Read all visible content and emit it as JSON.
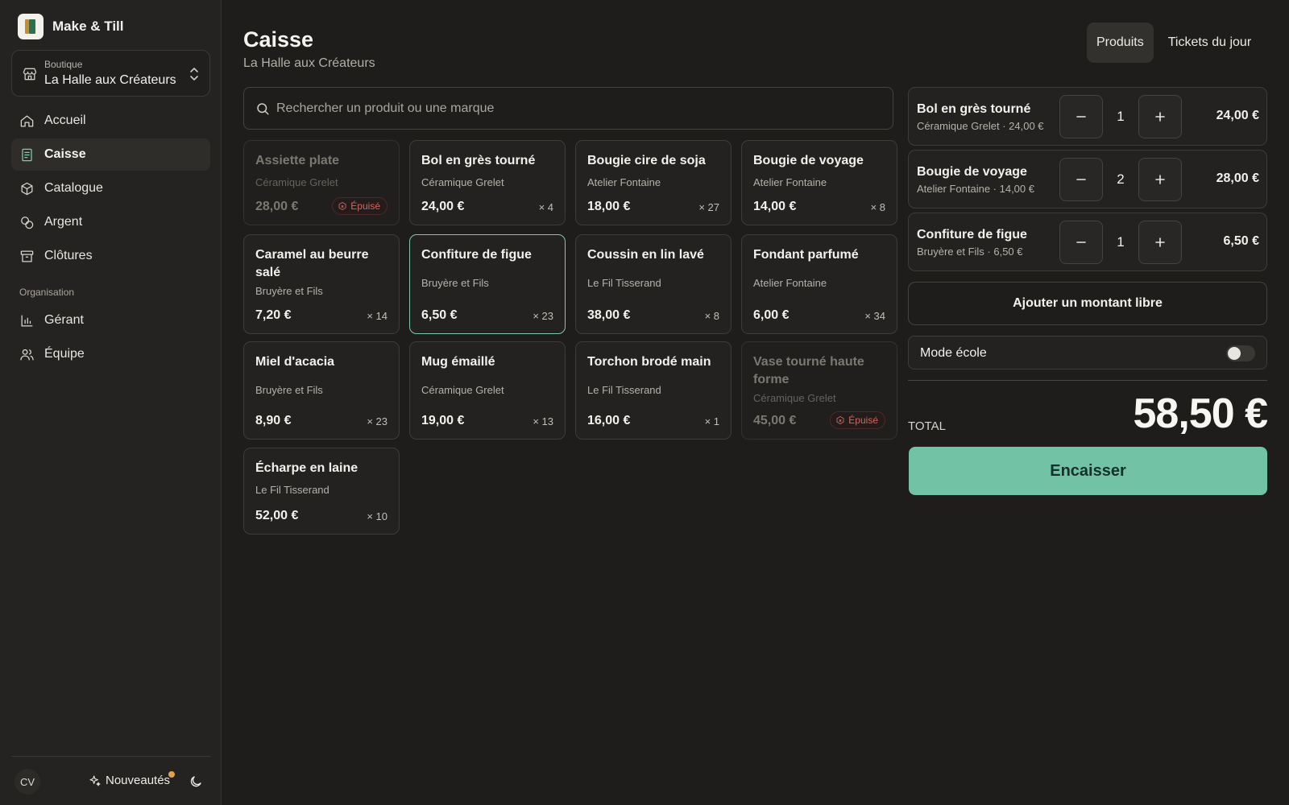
{
  "app": {
    "name": "Make & Till"
  },
  "store": {
    "label": "Boutique",
    "value": "La Halle aux Créateurs"
  },
  "nav": {
    "items": [
      {
        "label": "Accueil",
        "icon": "home-icon",
        "active": false
      },
      {
        "label": "Caisse",
        "icon": "receipt-icon",
        "active": true
      },
      {
        "label": "Catalogue",
        "icon": "box-icon",
        "active": false
      },
      {
        "label": "Argent",
        "icon": "coins-icon",
        "active": false
      },
      {
        "label": "Clôtures",
        "icon": "archive-icon",
        "active": false
      }
    ],
    "section": "Organisation",
    "org_items": [
      {
        "label": "Gérant",
        "icon": "chart-icon"
      },
      {
        "label": "Équipe",
        "icon": "users-icon"
      }
    ]
  },
  "footer": {
    "avatar": "CV",
    "news": "Nouveautés"
  },
  "page": {
    "title": "Caisse",
    "subtitle": "La Halle aux Créateurs"
  },
  "tabs": [
    {
      "label": "Produits",
      "active": true
    },
    {
      "label": "Tickets du jour",
      "active": false
    }
  ],
  "search": {
    "placeholder": "Rechercher un produit ou une marque",
    "value": ""
  },
  "products": [
    {
      "name": "Assiette plate",
      "brand": "Céramique Grelet",
      "price": "28,00 €",
      "stock": "",
      "soldout": true,
      "badge": "Épuisé"
    },
    {
      "name": "Bol en grès tourné",
      "brand": "Céramique Grelet",
      "price": "24,00 €",
      "stock": "× 4"
    },
    {
      "name": "Bougie cire de soja",
      "brand": "Atelier Fontaine",
      "price": "18,00 €",
      "stock": "× 27"
    },
    {
      "name": "Bougie de voyage",
      "brand": "Atelier Fontaine",
      "price": "14,00 €",
      "stock": "× 8"
    },
    {
      "name": "Caramel au beurre salé",
      "brand": "Bruyère et Fils",
      "price": "7,20 €",
      "stock": "× 14"
    },
    {
      "name": "Confiture de figue",
      "brand": "Bruyère et Fils",
      "price": "6,50 €",
      "stock": "× 23",
      "selected": true
    },
    {
      "name": "Coussin en lin lavé",
      "brand": "Le Fil Tisserand",
      "price": "38,00 €",
      "stock": "× 8"
    },
    {
      "name": "Fondant parfumé",
      "brand": "Atelier Fontaine",
      "price": "6,00 €",
      "stock": "× 34"
    },
    {
      "name": "Miel d'acacia",
      "brand": "Bruyère et Fils",
      "price": "8,90 €",
      "stock": "× 23"
    },
    {
      "name": "Mug émaillé",
      "brand": "Céramique Grelet",
      "price": "19,00 €",
      "stock": "× 13"
    },
    {
      "name": "Torchon brodé main",
      "brand": "Le Fil Tisserand",
      "price": "16,00 €",
      "stock": "× 1"
    },
    {
      "name": "Vase tourné haute forme",
      "brand": "Céramique Grelet",
      "price": "45,00 €",
      "stock": "",
      "soldout": true,
      "badge": "Épuisé"
    },
    {
      "name": "Écharpe en laine",
      "brand": "Le Fil Tisserand",
      "price": "52,00 €",
      "stock": "× 10"
    }
  ],
  "cart": [
    {
      "name": "Bol en grès tourné",
      "meta": "Céramique Grelet · 24,00 €",
      "qty": "1",
      "total": "24,00 €"
    },
    {
      "name": "Bougie de voyage",
      "meta": "Atelier Fontaine · 14,00 €",
      "qty": "2",
      "total": "28,00 €"
    },
    {
      "name": "Confiture de figue",
      "meta": "Bruyère et Fils · 6,50 €",
      "qty": "1",
      "total": "6,50 €"
    }
  ],
  "free_amount_label": "Ajouter un montant libre",
  "school_mode": {
    "label": "Mode école",
    "enabled": false
  },
  "total": {
    "label": "TOTAL",
    "value": "58,50 €"
  },
  "checkout_label": "Encaisser"
}
